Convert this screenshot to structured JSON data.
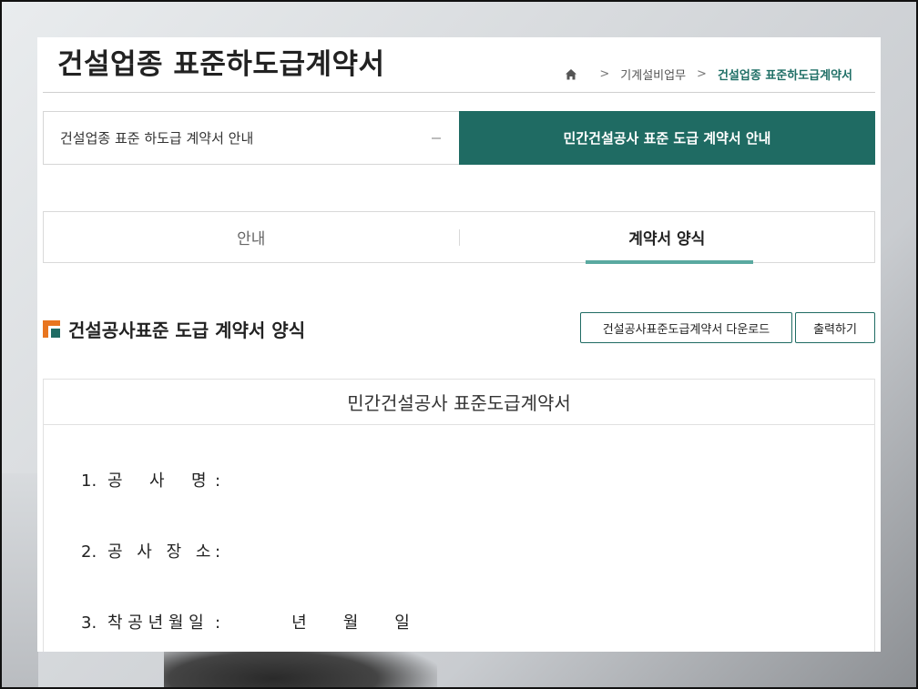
{
  "page": {
    "title": "건설업종 표준하도급계약서"
  },
  "breadcrumb": {
    "home_icon": "home-icon",
    "items": [
      "기계설비업무",
      "건설업종 표준하도급계약서"
    ]
  },
  "guide_tabs": [
    {
      "label": "건설업종 표준 하도급 계약서 안내",
      "active": false
    },
    {
      "label": "민간건설공사 표준 도급 계약서 안내",
      "active": true
    }
  ],
  "sub_tabs": [
    {
      "label": "안내",
      "active": false
    },
    {
      "label": "계약서 양식",
      "active": true
    }
  ],
  "section": {
    "title": "건설공사표준 도급 계약서 양식",
    "download_label": "건설공사표준도급계약서 다운로드",
    "print_label": "출력하기"
  },
  "document": {
    "title": "민간건설공사 표준도급계약서",
    "rows": [
      {
        "num": "1.",
        "label": "공  사  명",
        "colon": ":"
      },
      {
        "num": "2.",
        "label": "공 사 장 소",
        "colon": ":"
      },
      {
        "num": "3.",
        "label": "착 공 년 월 일",
        "colon": ":",
        "date": "년       월       일"
      }
    ]
  },
  "colors": {
    "accent": "#1f6b63",
    "accent_light": "#5aa9a0",
    "orange": "#e8751f"
  }
}
